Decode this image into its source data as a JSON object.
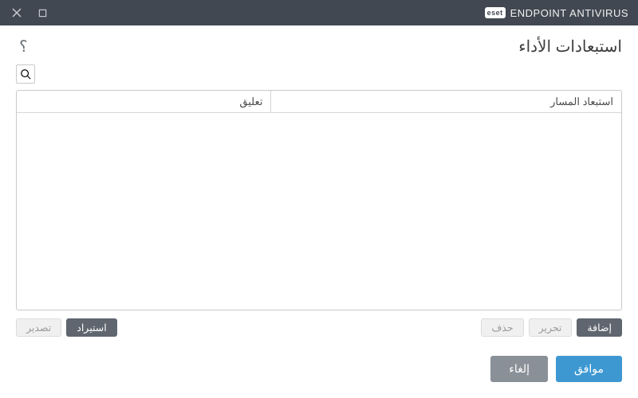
{
  "brand": {
    "badge": "eset",
    "product_a": "ENDPOINT",
    "product_b": "ANTIVIRUS"
  },
  "header": {
    "title": "استبعادات الأداء"
  },
  "table": {
    "columns": {
      "path": "استبعاد المسار",
      "comment": "تعليق"
    },
    "rows": []
  },
  "actions": {
    "add": "إضافة",
    "edit": "تحرير",
    "delete": "حذف",
    "import": "استيراد",
    "export": "تصدير"
  },
  "footer": {
    "ok": "موافق",
    "cancel": "إلغاء"
  }
}
